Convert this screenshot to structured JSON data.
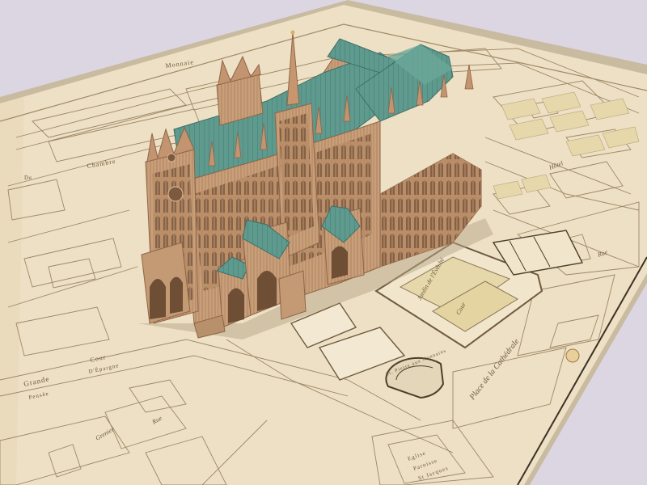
{
  "scene": {
    "subject": "3D model of a Gothic cathedral resting on an antique architectural site plan",
    "colors": {
      "background": "#d9d4e2",
      "paper": "#eee0c4",
      "paper_shadow": "#d8c7a4",
      "ink": "#8a7456",
      "stone": "#c99f7a",
      "stone_dark": "#9b7352",
      "roof": "#5f9a8e",
      "roof_dark": "#497f74",
      "garden": "#e6d8aa"
    }
  },
  "map": {
    "labels": {
      "north_street": "Monnaie",
      "west_street": "Chambre",
      "west_small": "De",
      "grande": "Grande",
      "cour": "Cour",
      "pensee": "Pensée",
      "epargne": "D'Épargne",
      "garden_1": "Jardin de l'Évêché",
      "garden_2": "Cour",
      "place": "Place de la Cathédrale",
      "church": "St. Pierre aux Nonnains",
      "bottom_left_1": "Grenier",
      "bottom_left_2": "Rue",
      "bottom_right_1": "Eglise",
      "bottom_right_2": "Paroisse",
      "bottom_right_3": "St Jacques",
      "east_1": "Hôtel",
      "east_2": "Rue"
    }
  }
}
